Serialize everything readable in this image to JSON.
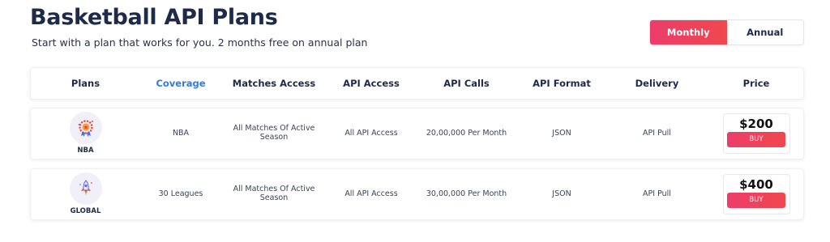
{
  "header": {
    "title": "Basketball API Plans",
    "subtitle": "Start with a plan that works for you. 2 months free on annual plan"
  },
  "billing_toggle": {
    "options": [
      {
        "label": "Monthly",
        "active": true
      },
      {
        "label": "Annual",
        "active": false
      }
    ],
    "accent_color": "#ef4058"
  },
  "table": {
    "columns": [
      "Plans",
      "Coverage",
      "Matches Access",
      "API Access",
      "API Calls",
      "API Format",
      "Delivery",
      "Price"
    ],
    "highlight_color": "#2d7be5",
    "rows": [
      {
        "plan": "NBA",
        "icon": "trophy-medal-icon",
        "coverage": "NBA",
        "matches_access": "All Matches Of Active Season",
        "api_access": "All API Access",
        "api_calls": "20,00,000 Per Month",
        "api_format": "JSON",
        "delivery": "API Pull",
        "price": "$200",
        "buy_label": "BUY"
      },
      {
        "plan": "GLOBAL",
        "icon": "rocket-icon",
        "coverage": "30 Leagues",
        "matches_access": "All Matches Of Active Season",
        "api_access": "All API Access",
        "api_calls": "30,00,000 Per Month",
        "api_format": "JSON",
        "delivery": "API Pull",
        "price": "$400",
        "buy_label": "BUY"
      }
    ]
  }
}
